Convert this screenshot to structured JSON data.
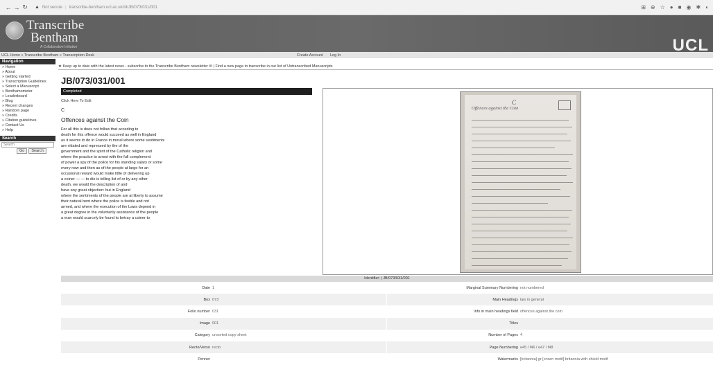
{
  "browser": {
    "security": "Not secure",
    "url": "transcribe-bentham.ucl.ac.uk/td/JB/073/031/001"
  },
  "header": {
    "logo_line1": "Transcribe",
    "logo_line2": "Bentham",
    "logo_sub": "A Collaborative Initiative",
    "ucl": "UCL"
  },
  "crumbs": {
    "path": "UCL Home » Transcribe Bentham » Transcription Desk",
    "create_account": "Create Account",
    "login": "Log In"
  },
  "sidebar": {
    "nav_title": "Navigation",
    "items": [
      "» Home",
      "» About",
      "» Getting started",
      "» Transcription Guidelines",
      "» Select a Manuscript",
      "» Benthamometer",
      "» Leaderboard",
      "» Blog",
      "» Recent changes",
      "» Random page",
      "» Credits",
      "» Citation guidelines",
      "» Contact Us",
      "» Help"
    ],
    "search_title": "Search",
    "search_placeholder": "Search",
    "go_label": "Go",
    "search_label": "Search"
  },
  "news": "★ Keep up to date with the latest news - subscribe to the Transcribe Bentham newsletter ✉ | Find a new page to transcribe in our list of Untranscribed Manuscripts",
  "page": {
    "title": "JB/073/031/001",
    "status": "Completed",
    "click_edit": "Click Here To Edit",
    "section_letter": "C",
    "heading": "Offences against the Coin",
    "lines": [
      "For all this is does not follow that acceding to",
      "death for this offence would succeed as well in England",
      "as it seems to do in France in moral where some sentiments",
      "are vitiated and repressed by the of the",
      "government and the spirit of the Catholic religion and",
      "where the practice to arrest with the full complement",
      "of power a spy of the police for his standing salary or some",
      "every now and then as of the people at large for an",
      "occasional reward would make little of delivering up",
      "a coiner — — to die is telling list of or by any other",
      "death, we would the description of and",
      "have any great objection: but in England",
      "where the sentiments of the people are at liberty to assume",
      "their natural bent where the police is feeble and not",
      "armed, and where the execution of the Laws depend in",
      "a great degree in the voluntarily assistance of the people",
      "a man would scarcely be found to betray a coiner to"
    ]
  },
  "manuscript": {
    "letter": "C",
    "title": "Offences against the Coin"
  },
  "metadata": {
    "identifier": "Identifier: | JB/073/031/001",
    "rows": [
      {
        "left_label": "Date",
        "left_value": "1",
        "right_label": "Marginal Summary Numbering",
        "right_value": "not numbered"
      },
      {
        "left_label": "Box",
        "left_value": "073",
        "right_label": "Main Headings",
        "right_value": "law in general"
      },
      {
        "left_label": "Folio number",
        "left_value": "031",
        "right_label": "Info in main headings field",
        "right_value": "offences against the coin"
      },
      {
        "left_label": "Image",
        "left_value": "001",
        "right_label": "Titles",
        "right_value": ""
      },
      {
        "left_label": "Category",
        "left_value": "unsorted copy sheet",
        "right_label": "Number of Pages",
        "right_value": "4"
      },
      {
        "left_label": "Recto/Verso",
        "left_value": "recto",
        "right_label": "Page Numbering",
        "right_value": "e45 / f46 / e47 / f48"
      },
      {
        "left_label": "Penner",
        "left_value": "",
        "right_label": "Watermarks",
        "right_value": "[britannia] gr [crown motif] britannia with shield motif"
      }
    ]
  }
}
